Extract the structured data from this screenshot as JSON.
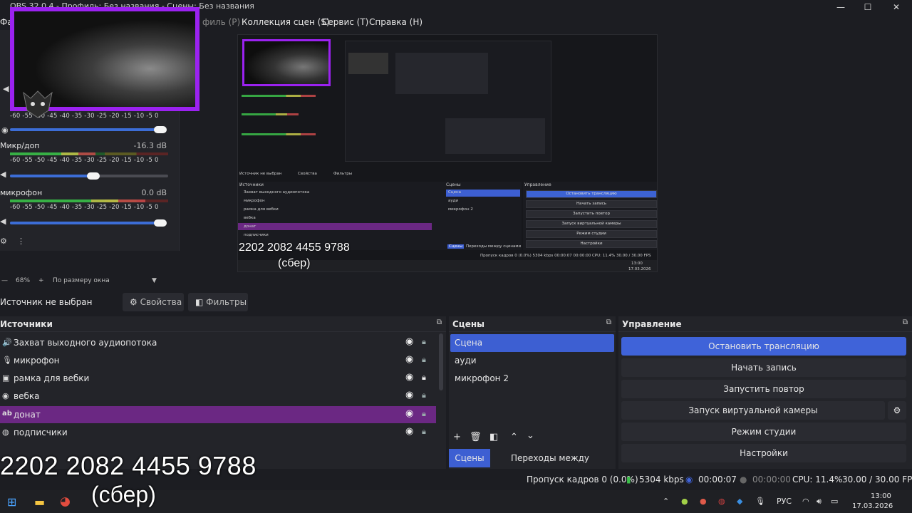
{
  "window": {
    "title": "OBS 32.0.4 - Профиль: Без названия - Сцены: Без названия",
    "minimize": "—",
    "maximize": "☐",
    "close": "✕"
  },
  "menu": {
    "items": [
      "Фа",
      "филь (P)",
      "Коллекция сцен (S)",
      "Сервис (T)",
      "Справка (H)"
    ]
  },
  "mixer": {
    "ticks": "-60 -55 -50 -45 -40 -35 -30 -25 -20 -15 -10 -5 0",
    "channels": [
      {
        "name": "",
        "db": ""
      },
      {
        "name": "Микр/доп",
        "db": "-16.3 dB"
      },
      {
        "name": "микрофон",
        "db": "0.0 dB"
      }
    ]
  },
  "preview": {
    "sources_title": "Источники",
    "scenes_title": "Сцены",
    "controls_title": "Управление",
    "no_source": "Источник не выбран",
    "properties": "Свойства",
    "filters": "Фильтры",
    "sources": [
      "Захват выходного аудиопотока",
      "микрофон",
      "рамка для вебки",
      "вебка",
      "донат",
      "подписчики"
    ],
    "scenes": [
      "Сцена",
      "ауди",
      "микрофон 2"
    ],
    "controls": [
      "Остановить трансляцию",
      "Начать запись",
      "Запустить повтор",
      "Запуск виртуальной камеры",
      "Режим студии",
      "Настройки"
    ],
    "tab_scenes": "Сцены",
    "tab_transitions": "Переходы между сценами",
    "card": "2202 2082 4455 9788",
    "bank": "(сбер)",
    "status": "Пропуск кадров 0 (0.0%)   5304 kbps   00:00:07   00:00:00   CPU: 11.4%   30.00 / 30.00 FPS",
    "time": "13:00",
    "date": "17.03.2026"
  },
  "zoom": {
    "minus": "—",
    "value": "68%",
    "plus": "+",
    "mode": "По размеру окна",
    "arrow": "▼"
  },
  "context": {
    "label": "Источник не выбран",
    "properties": "Свойства",
    "filters": "Фильтры"
  },
  "sources": {
    "title": "Источники",
    "items": [
      {
        "icon": "🔊",
        "name": "Захват выходного аудиопотока"
      },
      {
        "icon": "🎙",
        "name": "микрофон"
      },
      {
        "icon": "▣",
        "name": "рамка для вебки"
      },
      {
        "icon": "◉",
        "name": "вебка"
      },
      {
        "icon": "ab",
        "name": "донат"
      },
      {
        "icon": "◍",
        "name": "подписчики"
      }
    ]
  },
  "scenes": {
    "title": "Сцены",
    "items": [
      "Сцена",
      "ауди",
      "микрофон 2"
    ],
    "tab_scenes": "Сцены",
    "tab_transitions": "Переходы между сценами"
  },
  "controls": {
    "title": "Управление",
    "buttons": [
      "Остановить трансляцию",
      "Начать запись",
      "Запустить повтор",
      "Запуск виртуальной камеры",
      "Режим студии",
      "Настройки"
    ]
  },
  "status": {
    "dropped": "Пропуск кадров 0 (0.0%)",
    "bitrate": "5304 kbps",
    "stream_time": "00:00:07",
    "rec_time": "00:00:00",
    "cpu": "CPU: 11.4%",
    "fps": "30.00 / 30.00 FPS"
  },
  "taskbar": {
    "lang": "РУС",
    "time": "13:00",
    "date": "17.03.2026"
  },
  "overlay": {
    "card": "2202 2082 4455 9788",
    "bank": "(сбер)"
  },
  "colors": {
    "accent_blue": "#3f63d9",
    "selected_purple": "#6b2883",
    "webcam_border": "#9b22f0"
  }
}
